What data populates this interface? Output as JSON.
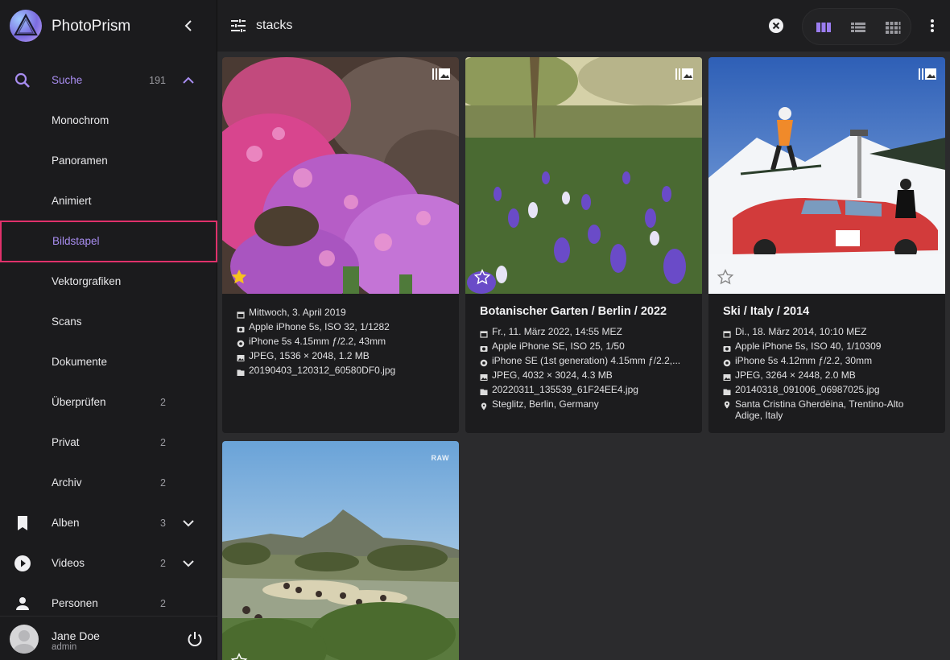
{
  "app": {
    "name": "PhotoPrism"
  },
  "colors": {
    "accent": "#a88df0",
    "selected_outline": "#e0316b",
    "sidebar_bg": "#1b1b1d",
    "card_bg": "#1c1c1e",
    "star_gold": "#f7c21e"
  },
  "sidebar": {
    "items": [
      {
        "label": "Suche",
        "count": "191",
        "icon": "search-icon",
        "expanded": true
      },
      {
        "label": "Monochrom"
      },
      {
        "label": "Panoramen"
      },
      {
        "label": "Animiert"
      },
      {
        "label": "Bildstapel",
        "selected": true
      },
      {
        "label": "Vektorgrafiken"
      },
      {
        "label": "Scans"
      },
      {
        "label": "Dokumente"
      },
      {
        "label": "Überprüfen",
        "count": "2"
      },
      {
        "label": "Privat",
        "count": "2"
      },
      {
        "label": "Archiv",
        "count": "2"
      },
      {
        "label": "Alben",
        "count": "3",
        "icon": "bookmark-icon"
      },
      {
        "label": "Videos",
        "count": "2",
        "icon": "play-circle-icon"
      },
      {
        "label": "Personen",
        "count": "2",
        "icon": "person-icon"
      }
    ],
    "user": {
      "name": "Jane Doe",
      "role": "admin"
    }
  },
  "toolbar": {
    "search_value": "stacks",
    "views": [
      "cards-view-icon",
      "list-view-icon",
      "mosaic-view-icon"
    ],
    "active_view": "cards"
  },
  "cards": [
    {
      "title": "",
      "favorite": true,
      "badge": "stack",
      "rows": [
        {
          "icon": "calendar-icon",
          "text": "Mittwoch, 3. April 2019"
        },
        {
          "icon": "camera-icon",
          "text": "Apple iPhone 5s, ISO 32, 1/1282"
        },
        {
          "icon": "lens-icon",
          "text": "iPhone 5s 4.15mm ƒ/2.2, 43mm"
        },
        {
          "icon": "image-icon",
          "text": "JPEG, 1536 × 2048, 1.2 MB"
        },
        {
          "icon": "file-icon",
          "text": "20190403_120312_60580DF0.jpg"
        }
      ]
    },
    {
      "title": "Botanischer Garten / Berlin / 2022",
      "favorite": false,
      "badge": "stack",
      "rows": [
        {
          "icon": "calendar-icon",
          "text": "Fr., 11. März 2022, 14:55 MEZ"
        },
        {
          "icon": "camera-icon",
          "text": "Apple iPhone SE, ISO 25, 1/50"
        },
        {
          "icon": "lens-icon",
          "text": "iPhone SE (1st generation) 4.15mm ƒ/2.2,..."
        },
        {
          "icon": "image-icon",
          "text": "JPEG, 4032 × 3024, 4.3 MB"
        },
        {
          "icon": "file-icon",
          "text": "20220311_135539_61F24EE4.jpg"
        },
        {
          "icon": "location-icon",
          "text": "Steglitz, Berlin, Germany"
        }
      ]
    },
    {
      "title": "Ski / Italy / 2014",
      "favorite": false,
      "badge": "stack",
      "rows": [
        {
          "icon": "calendar-icon",
          "text": "Di., 18. März 2014, 10:10 MEZ"
        },
        {
          "icon": "camera-icon",
          "text": "Apple iPhone 5s, ISO 40, 1/10309"
        },
        {
          "icon": "lens-icon",
          "text": "iPhone 5s 4.12mm ƒ/2.2, 30mm"
        },
        {
          "icon": "image-icon",
          "text": "JPEG, 3264 × 2448, 2.0 MB"
        },
        {
          "icon": "file-icon",
          "text": "20140318_091006_06987025.jpg"
        },
        {
          "icon": "location-icon",
          "text": "Santa Cristina Gherdëina, Trentino-Alto Adige, Italy"
        }
      ]
    },
    {
      "title": "",
      "favorite": false,
      "badge": "RAW",
      "rows": []
    }
  ]
}
